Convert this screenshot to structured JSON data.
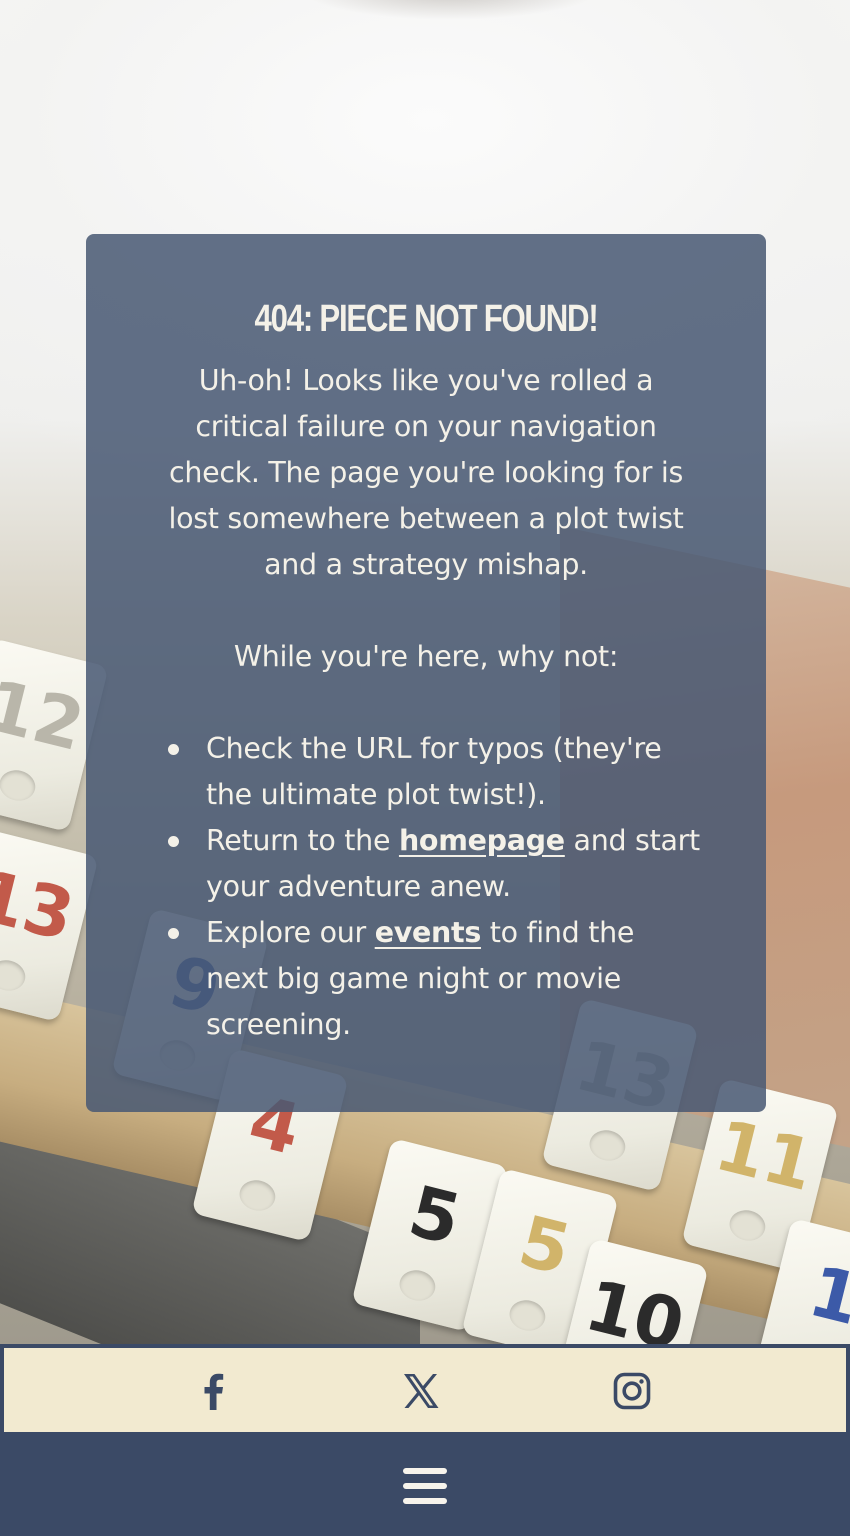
{
  "error_card": {
    "title": "404: PIECE NOT FOUND!",
    "intro": "Uh-oh! Looks like you've rolled a critical failure on your navigation check. The page you're looking for is lost somewhere between a plot twist and a strategy mishap.",
    "suggestions_heading": "While you're here, why not:",
    "suggestions": [
      {
        "text": "Check the URL for typos (they're the ultimate plot twist!)."
      },
      {
        "before": "Return to the ",
        "link": "homepage",
        "after": " and start your adventure anew."
      },
      {
        "before": "Explore our ",
        "link": "events",
        "after": " to find the next big game night or movie screening."
      }
    ]
  },
  "social": {
    "icons": [
      "facebook-icon",
      "x-icon",
      "instagram-icon"
    ]
  },
  "nav": {
    "icon": "hamburger-menu-icon"
  },
  "colors": {
    "card_bg": "#485873",
    "footer_bg": "#3b4a66",
    "social_bar_bg": "#f2ead0",
    "icon_color": "#3b4a66",
    "text": "#f4f1e8"
  }
}
